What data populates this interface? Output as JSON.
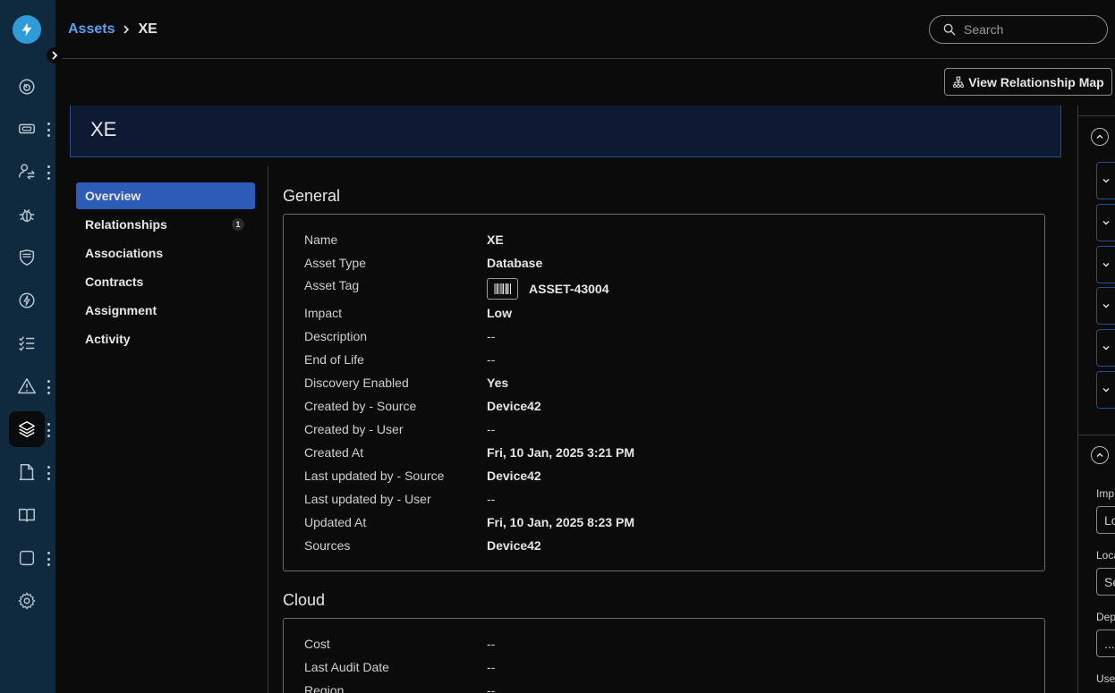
{
  "sidebar": {
    "items": [
      {
        "icon": "dashboard-gauge-icon",
        "has_menu": false
      },
      {
        "icon": "ticket-icon",
        "has_menu": true
      },
      {
        "icon": "user-exchange-icon",
        "has_menu": true
      },
      {
        "icon": "bug-icon",
        "has_menu": false
      },
      {
        "icon": "shield-icon",
        "has_menu": false
      },
      {
        "icon": "lightning-circle-icon",
        "has_menu": false
      },
      {
        "icon": "checklist-icon",
        "has_menu": false
      },
      {
        "icon": "warning-triangle-icon",
        "has_menu": true
      },
      {
        "icon": "layers-stack-icon",
        "has_menu": true,
        "active": true
      },
      {
        "icon": "document-icon",
        "has_menu": true
      },
      {
        "icon": "open-book-icon",
        "has_menu": false
      },
      {
        "icon": "square-icon",
        "has_menu": true
      },
      {
        "icon": "gear-icon",
        "has_menu": false
      }
    ]
  },
  "header": {
    "breadcrumb_parent": "Assets",
    "breadcrumb_current": "XE",
    "search_placeholder": "Search"
  },
  "toolbar": {
    "relationship_map_label": "View Relationship Map"
  },
  "banner": {
    "title": "XE"
  },
  "tabs": [
    {
      "label": "Overview",
      "active": true
    },
    {
      "label": "Relationships",
      "badge": "1"
    },
    {
      "label": "Associations"
    },
    {
      "label": "Contracts"
    },
    {
      "label": "Assignment"
    },
    {
      "label": "Activity"
    }
  ],
  "general": {
    "title": "General",
    "fields": [
      {
        "label": "Name",
        "value": "XE"
      },
      {
        "label": "Asset Type",
        "value": "Database"
      },
      {
        "label": "Asset Tag",
        "value": "ASSET-43004"
      },
      {
        "label": "Impact",
        "value": "Low"
      },
      {
        "label": "Description",
        "value": "--"
      },
      {
        "label": "End of Life",
        "value": "--"
      },
      {
        "label": "Discovery Enabled",
        "value": "Yes"
      },
      {
        "label": "Created by - Source",
        "value": "Device42"
      },
      {
        "label": "Created by - User",
        "value": "--"
      },
      {
        "label": "Created At",
        "value": "Fri, 10 Jan, 2025 3:21 PM"
      },
      {
        "label": "Last updated by - Source",
        "value": "Device42"
      },
      {
        "label": "Last updated by - User",
        "value": "--"
      },
      {
        "label": "Updated At",
        "value": "Fri, 10 Jan, 2025 8:23 PM"
      },
      {
        "label": "Sources",
        "value": "Device42"
      }
    ]
  },
  "cloud": {
    "title": "Cloud",
    "fields": [
      {
        "label": "Cost",
        "value": "--"
      },
      {
        "label": "Last Audit Date",
        "value": "--"
      },
      {
        "label": "Region",
        "value": "--"
      }
    ]
  },
  "right_panel": {
    "labels": [
      "Imp",
      "Loca",
      "Dep",
      "Use"
    ],
    "inputs": [
      "Lo",
      "Se",
      "..."
    ]
  },
  "colors": {
    "sidebar_bg": "#0f2a3f",
    "accent": "#2d5bb8",
    "link": "#5aa0f0",
    "banner_bg": "#0e1a33"
  }
}
